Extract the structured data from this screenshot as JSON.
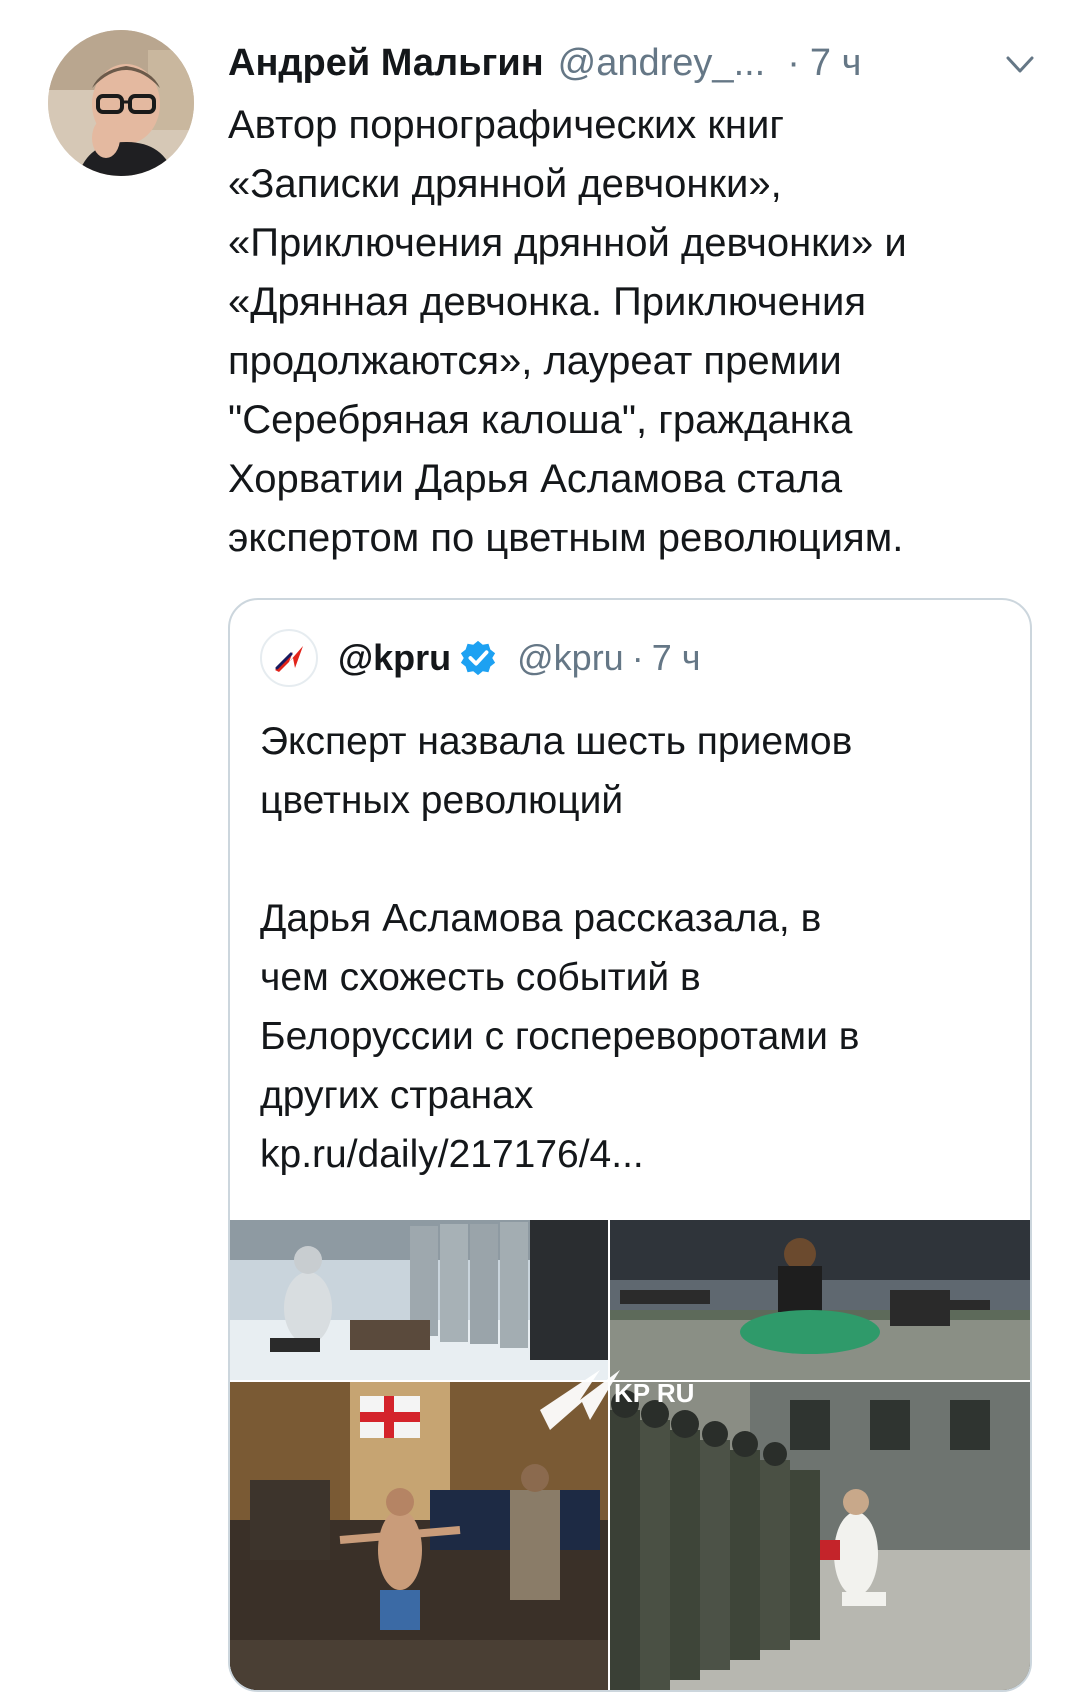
{
  "tweet": {
    "author_name": "Андрей Мальгин",
    "author_handle": "@andrey_...",
    "separator": "·",
    "time": "7 ч",
    "text_lines": [
      "Автор порнографических книг",
      "«Записки дрянной девчонки»,",
      "«Приключения дрянной девчонки» и",
      "«Дрянная девчонка. Приключения",
      "продолжаются», лауреат премии",
      "\"Серебряная калоша\", гражданка",
      "Хорватии Дарья Асламова стала",
      "экспертом по цветным революциям."
    ],
    "avatar_icon": "user-avatar",
    "menu_icon": "chevron-down-icon"
  },
  "quoted_tweet": {
    "name": "@kpru",
    "verified_icon": "verified-badge-icon",
    "handle": "@kpru",
    "separator": "·",
    "time": "7 ч",
    "title_lines": [
      "Эксперт назвала шесть приемов",
      "цветных революций"
    ],
    "body_lines": [
      "Дарья Асламова рассказала, в",
      "чем схожесть событий в",
      "Белоруссии с госпереворотами в",
      "других странах"
    ],
    "link": "kp.ru/daily/217176/4...",
    "media_watermark": "KP RU",
    "colors": {
      "verified_blue": "#1da1f2",
      "kp_red": "#e2231a"
    }
  }
}
